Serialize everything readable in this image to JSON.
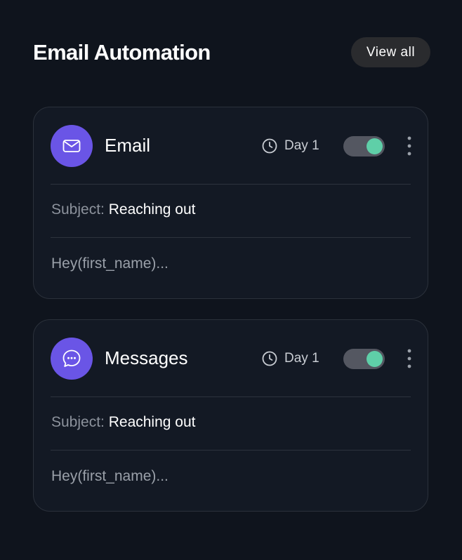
{
  "header": {
    "title": "Email Automation",
    "view_all_label": "View all"
  },
  "cards": [
    {
      "name": "Email",
      "icon": "envelope-icon",
      "schedule": "Day 1",
      "enabled": true,
      "subject_label": "Subject:",
      "subject_value": "Reaching out",
      "preview": "Hey(first_name)..."
    },
    {
      "name": "Messages",
      "icon": "chat-bubble-icon",
      "schedule": "Day 1",
      "enabled": true,
      "subject_label": "Subject:",
      "subject_value": "Reaching out",
      "preview": "Hey(first_name)..."
    }
  ],
  "colors": {
    "background": "#0f141d",
    "card_background": "#131924",
    "accent_purple": "#6a55e6",
    "toggle_on": "#5fcfa8",
    "toggle_track": "#545761"
  }
}
